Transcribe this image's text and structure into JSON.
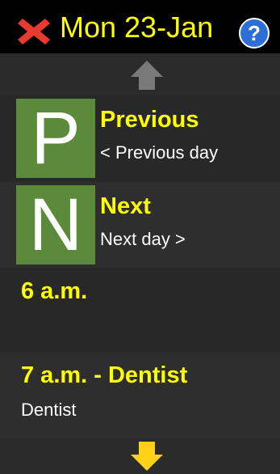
{
  "header": {
    "close_icon": "red-x-icon",
    "title": "Mon 23-Jan",
    "help_label": "?",
    "help_icon": "help-circle-icon"
  },
  "nav": {
    "up_icon": "arrow-up-icon",
    "down_icon": "arrow-down-icon"
  },
  "items": [
    {
      "tile": "P",
      "title": "Previous",
      "subtitle": "< Previous day"
    },
    {
      "tile": "N",
      "title": "Next",
      "subtitle": "Next day >"
    }
  ],
  "slots": [
    {
      "title": "6 a.m.",
      "subtitle": ""
    },
    {
      "title": "7 a.m. - Dentist",
      "subtitle": "Dentist"
    }
  ],
  "colors": {
    "accent_yellow": "#ffff00",
    "tile_green": "#5a8a3a",
    "background": "#2b2b2b",
    "header_bg": "#000000",
    "up_arrow": "#7a7a7a",
    "down_arrow": "#ffd21a"
  }
}
